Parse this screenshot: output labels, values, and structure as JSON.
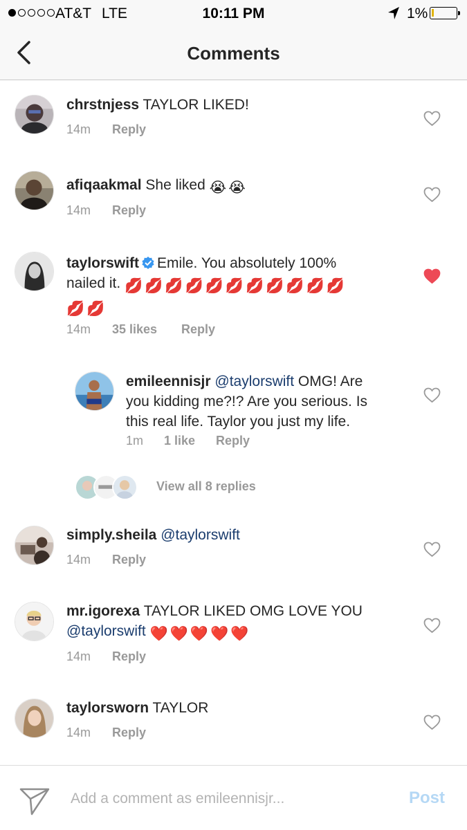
{
  "status_bar": {
    "carrier": "AT&T",
    "network": "LTE",
    "time": "10:11 PM",
    "battery": "1%"
  },
  "header": {
    "title": "Comments"
  },
  "comments": [
    {
      "username": "chrstnjess",
      "text": "TAYLOR LIKED!",
      "time": "14m",
      "reply": "Reply",
      "liked": false
    },
    {
      "username": "afiqaakmal",
      "text": "She liked",
      "emoji": [
        "😭",
        "😭"
      ],
      "time": "14m",
      "reply": "Reply",
      "liked": false
    },
    {
      "username": "taylorswift",
      "verified": true,
      "text_line1": "Emile. You absolutely 100%",
      "text_line2": "nailed it.",
      "emoji": [
        "💋",
        "💋",
        "💋",
        "💋",
        "💋",
        "💋",
        "💋",
        "💋",
        "💋",
        "💋",
        "💋",
        "💋",
        "💋"
      ],
      "time": "14m",
      "likes": "35 likes",
      "reply": "Reply",
      "liked": true
    },
    {
      "username": "emileennisjr",
      "mention": "@taylorswift",
      "text_line1": "OMG! Are",
      "text_line2": "you kidding me?!? Are you serious. Is",
      "text_line3": "this real life. Taylor you just my life.",
      "time": "1m",
      "likes": "1 like",
      "reply": "Reply",
      "liked": false
    },
    {
      "username": "simply.sheila",
      "mention": "@taylorswift",
      "time": "14m",
      "reply": "Reply",
      "liked": false
    },
    {
      "username": "mr.igorexa",
      "text": "TAYLOR LIKED OMG LOVE YOU",
      "mention": "@taylorswift",
      "emoji": [
        "❤️",
        "❤️",
        "❤️",
        "❤️",
        "❤️"
      ],
      "time": "14m",
      "reply": "Reply",
      "liked": false
    },
    {
      "username": "taylorsworn",
      "text": "TAYLOR",
      "time": "14m",
      "reply": "Reply",
      "liked": false
    }
  ],
  "view_replies": {
    "label": "View all 8 replies"
  },
  "input": {
    "placeholder": "Add a comment as emileennisjr...",
    "post_label": "Post"
  },
  "colors": {
    "text": "#262626",
    "muted": "#999999",
    "mention": "#1b3d6e",
    "heart_liked": "#ed4956",
    "verified": "#3897f0",
    "post_disabled": "#b5d8f5"
  },
  "icons": {
    "back": "chevron-left-icon",
    "heart": "heart-icon",
    "send": "paper-plane-icon",
    "verified": "verified-badge-icon",
    "location": "location-arrow-icon"
  }
}
